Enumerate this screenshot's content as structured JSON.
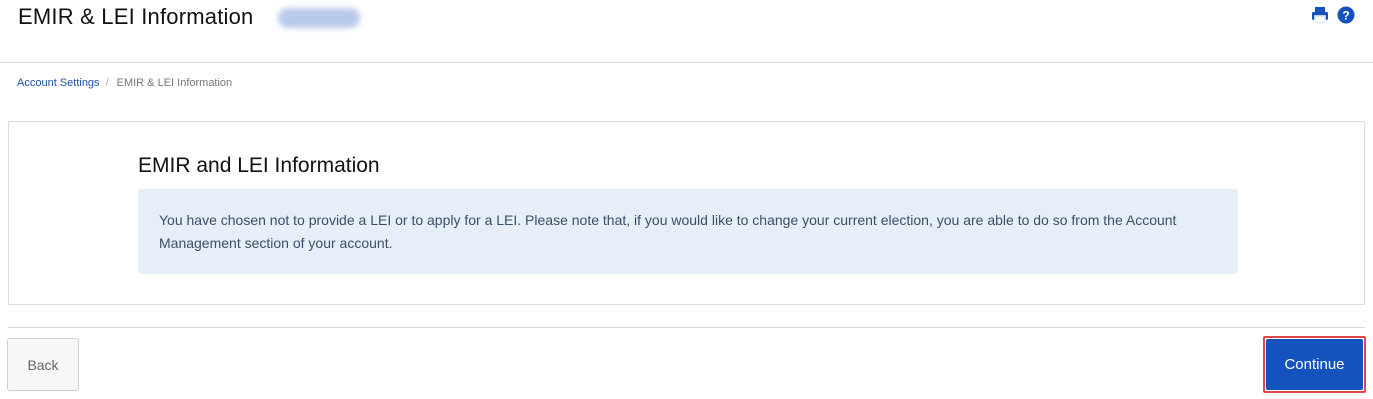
{
  "header": {
    "title": "EMIR & LEI Information",
    "icons": [
      "print-icon",
      "help-icon"
    ],
    "accent_color": "#1452be"
  },
  "breadcrumb": {
    "items": [
      "Account Settings",
      "EMIR & LEI Information"
    ],
    "separator": "/"
  },
  "panel": {
    "title": "EMIR and LEI Information",
    "message": "You have chosen not to provide a LEI or to apply for a LEI. Please note that, if you would like to change your current election, you are able to do so from the Account Management section of your account.",
    "message_bg": "#e6eef8"
  },
  "footer": {
    "back_label": "Back",
    "continue_label": "Continue",
    "continue_color": "#1452be"
  }
}
